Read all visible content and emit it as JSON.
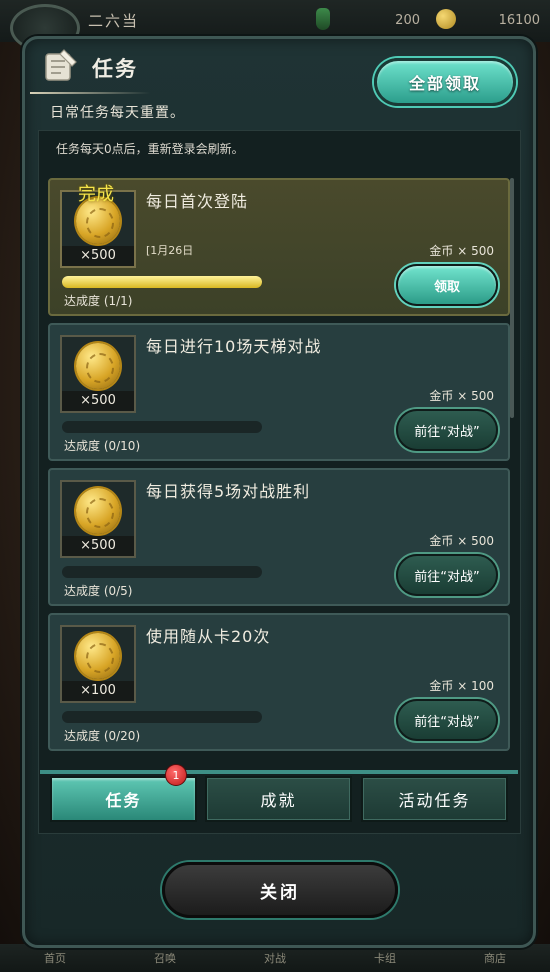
{
  "topbar": {
    "name": "二六当",
    "value1": "200",
    "value2": "16100"
  },
  "bottom_nav": [
    "首页",
    "召唤",
    "对战",
    "卡组",
    "商店"
  ],
  "panel": {
    "title": "任务",
    "claim_all": "全部领取",
    "subtitle": "日常任务每天重置。",
    "notice": "任务每天0点后，重新登录会刷新。"
  },
  "tasks": [
    {
      "title": "每日首次登陆",
      "count": "×500",
      "date": "[1月26日",
      "reward": "金币 × 500",
      "progress_text": "达成度 (1/1)",
      "progress": 1.0,
      "button": "领取",
      "done_label": "完成"
    },
    {
      "title": "每日进行10场天梯对战",
      "count": "×500",
      "reward": "金币 × 500",
      "progress_text": "达成度 (0/10)",
      "progress": 0,
      "button": "前往“对战”"
    },
    {
      "title": "每日获得5场对战胜利",
      "count": "×500",
      "reward": "金币 × 500",
      "progress_text": "达成度 (0/5)",
      "progress": 0,
      "button": "前往“对战”"
    },
    {
      "title": "使用随从卡20次",
      "count": "×100",
      "reward": "金币 × 100",
      "progress_text": "达成度 (0/20)",
      "progress": 0,
      "button": "前往“对战”"
    }
  ],
  "tabs": [
    "任务",
    "成就",
    "活动任务"
  ],
  "badge": "1",
  "close": "关闭"
}
